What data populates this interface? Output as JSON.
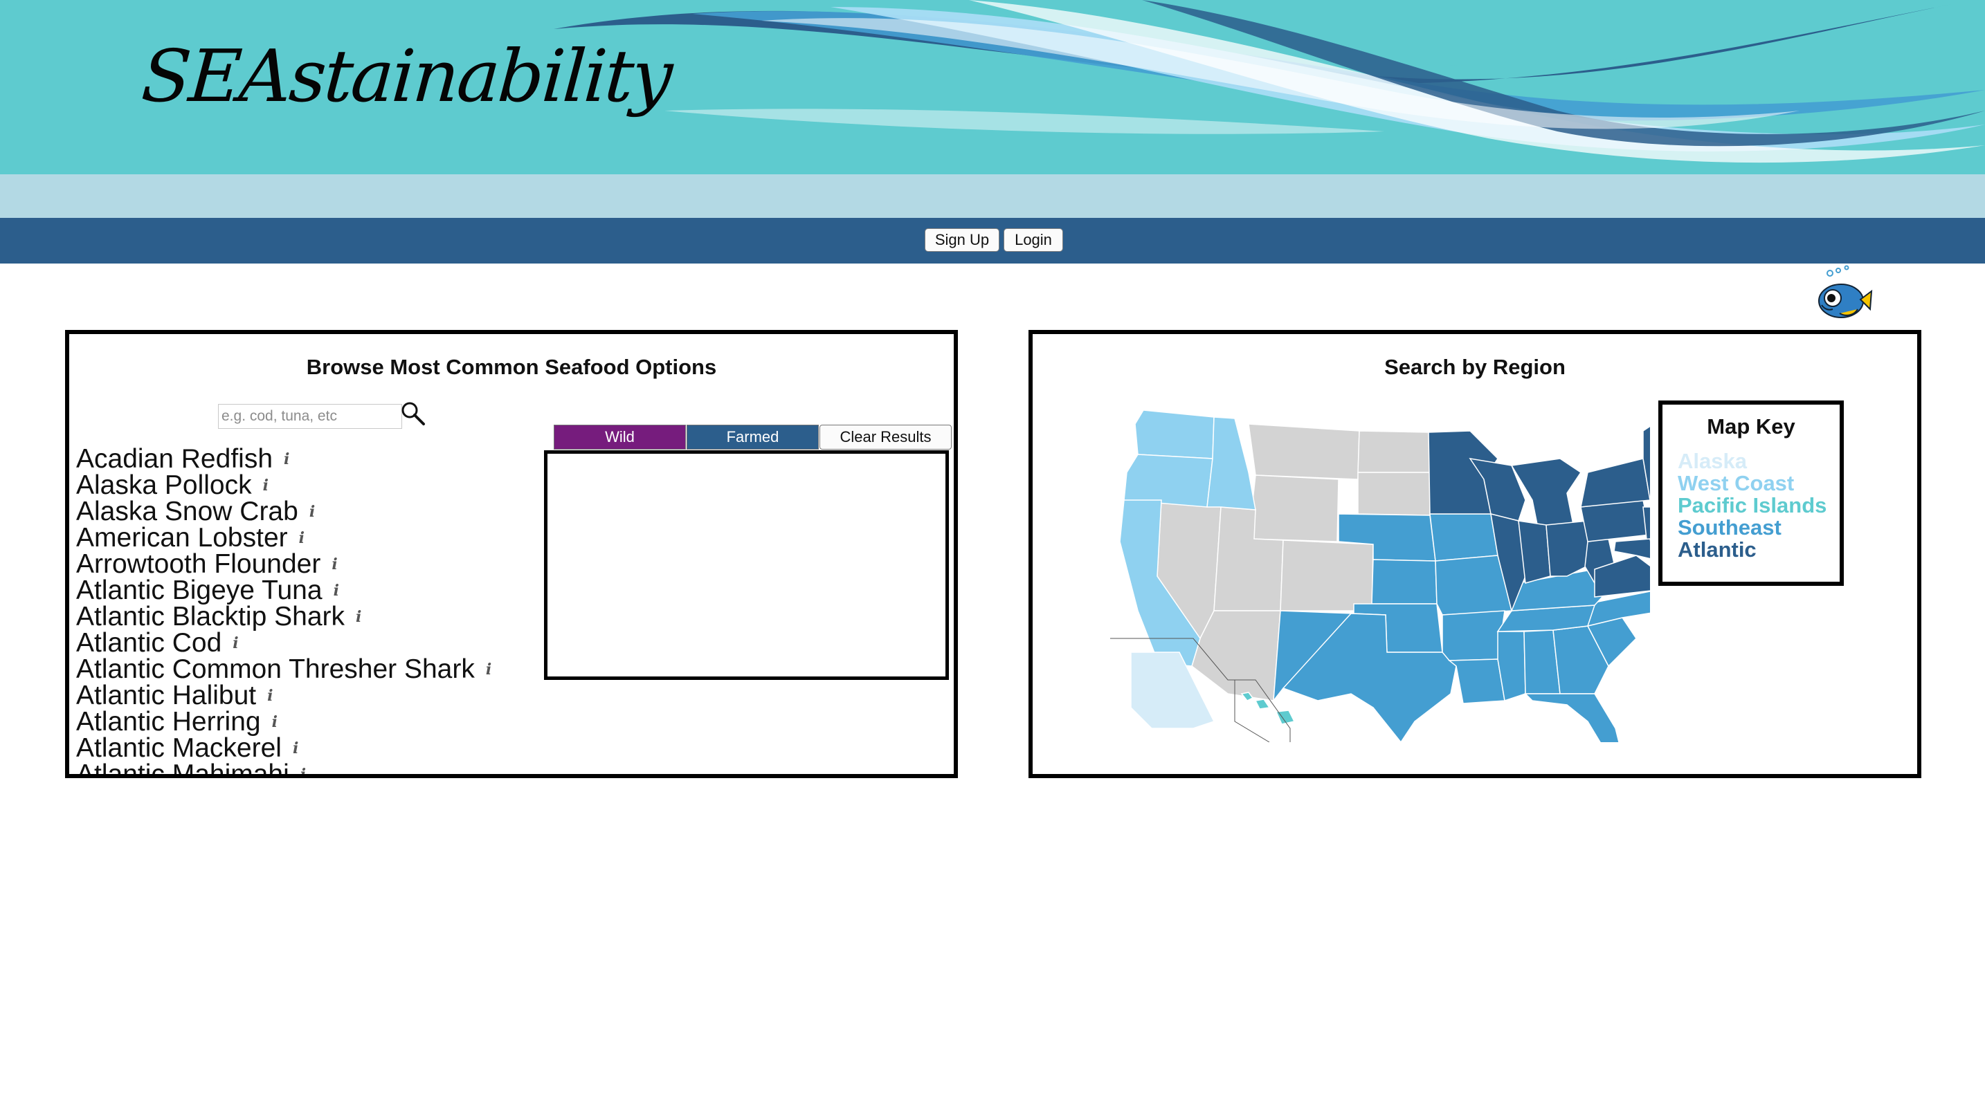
{
  "app": {
    "logo_text": "SEAstainability"
  },
  "nav": {
    "signup_label": "Sign Up",
    "login_label": "Login"
  },
  "browse": {
    "title": "Browse Most Common Seafood Options",
    "search_placeholder": "e.g. cod, tuna, etc",
    "search_value": "",
    "info_glyph": "i",
    "species": [
      "Acadian Redfish",
      "Alaska Pollock",
      "Alaska Snow Crab",
      "American Lobster",
      "Arrowtooth Flounder",
      "Atlantic Bigeye Tuna",
      "Atlantic Blacktip Shark",
      "Atlantic Cod",
      "Atlantic Common Thresher Shark",
      "Atlantic Halibut",
      "Atlantic Herring",
      "Atlantic Mackerel",
      "Atlantic Mahimahi"
    ],
    "filters": {
      "wild_label": "Wild",
      "farmed_label": "Farmed",
      "clear_label": "Clear Results"
    }
  },
  "region": {
    "title": "Search by Region",
    "map_key": {
      "title": "Map Key",
      "items": [
        {
          "label": "Alaska",
          "color": "#d6ecf8"
        },
        {
          "label": "West Coast",
          "color": "#8fd1f0"
        },
        {
          "label": "Pacific Islands",
          "color": "#5ecbcf"
        },
        {
          "label": "Southeast",
          "color": "#449ed1"
        },
        {
          "label": "Atlantic",
          "color": "#2c5e8c"
        }
      ]
    },
    "unassigned_color": "#d3d3d3"
  },
  "icons": {
    "search": "search-icon",
    "mascot": "fish-mascot-icon",
    "info": "info-icon"
  },
  "colors": {
    "header_bg": "#5ecbcf",
    "subband_bg": "#b3d9e4",
    "nav_bg": "#2c5e8c",
    "wild_btn": "#761c7d",
    "farmed_btn": "#2c5e8c"
  }
}
